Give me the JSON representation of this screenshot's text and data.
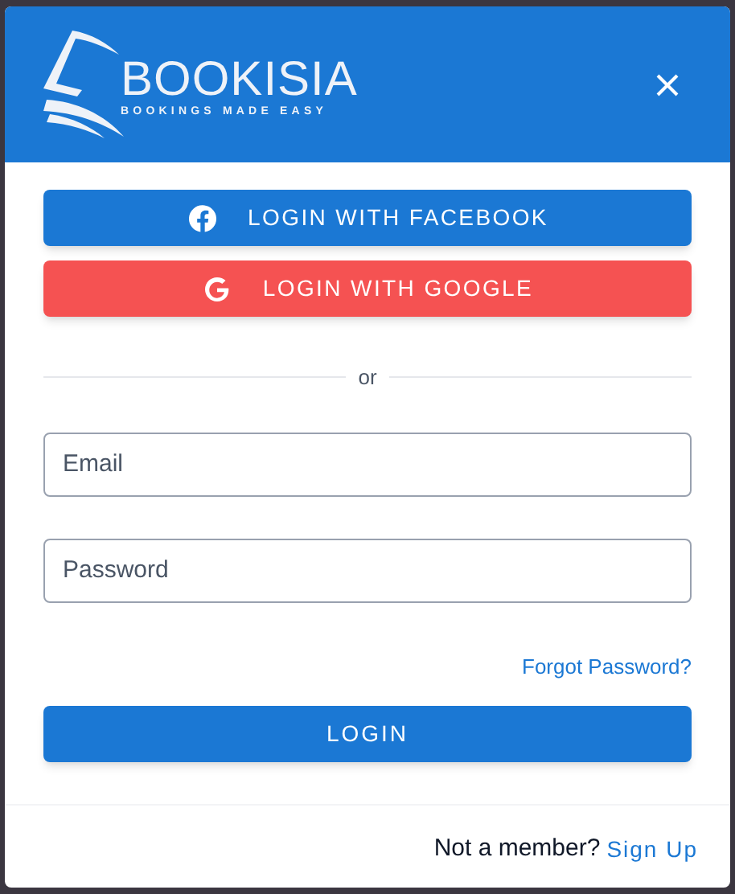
{
  "logo": {
    "name": "BOOKISIA",
    "tagline": "BOOKINGS MADE EASY"
  },
  "social_buttons": [
    {
      "kind": "facebook",
      "label": "LOGIN WITH FACEBOOK"
    },
    {
      "kind": "google",
      "label": "LOGIN WITH GOOGLE"
    }
  ],
  "divider": "or",
  "fields": [
    {
      "placeholder": "Email"
    },
    {
      "placeholder": "Password"
    }
  ],
  "forgot_link": "Forgot Password?",
  "login_button": "LOGIN",
  "footer": {
    "text": "Not a member?",
    "link": "Sign Up"
  }
}
